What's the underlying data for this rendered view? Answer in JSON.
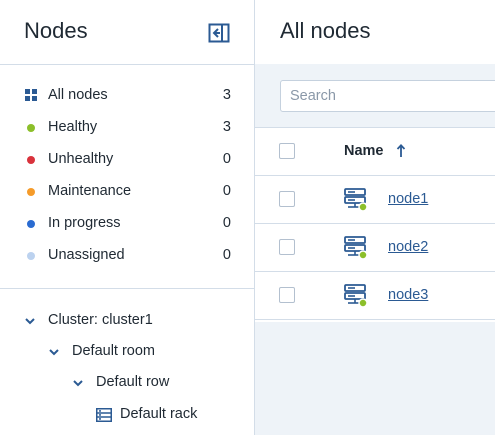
{
  "sidebar": {
    "title": "Nodes",
    "collapse_icon": "collapse-panel-icon",
    "filters": [
      {
        "label": "All nodes",
        "count": "3",
        "icon": "grid-icon",
        "color": "#2b5a93"
      },
      {
        "label": "Healthy",
        "count": "3",
        "icon": "status-dot-icon",
        "color": "#8cbf2a"
      },
      {
        "label": "Unhealthy",
        "count": "0",
        "icon": "status-dot-icon",
        "color": "#d9323c"
      },
      {
        "label": "Maintenance",
        "count": "0",
        "icon": "status-dot-icon",
        "color": "#f59b2a"
      },
      {
        "label": "In progress",
        "count": "0",
        "icon": "status-dot-icon",
        "color": "#2a6bd1"
      },
      {
        "label": "Unassigned",
        "count": "0",
        "icon": "status-dot-icon",
        "color": "#bcd2ef"
      }
    ],
    "tree": [
      {
        "label": "Cluster: cluster1",
        "icon": "chevron-down-icon"
      },
      {
        "label": "Default room",
        "icon": "chevron-down-icon"
      },
      {
        "label": "Default row",
        "icon": "chevron-down-icon"
      },
      {
        "label": "Default rack",
        "icon": "rack-icon"
      }
    ]
  },
  "main": {
    "title": "All nodes",
    "search": {
      "placeholder": "Search",
      "value": ""
    },
    "table": {
      "columns": [
        {
          "label": "Name",
          "sort": "ascending",
          "sort_icon": "arrow-up-icon"
        }
      ],
      "rows": [
        {
          "name": "node1",
          "icon": "server-node-icon",
          "status": "Healthy"
        },
        {
          "name": "node2",
          "icon": "server-node-icon",
          "status": "Healthy"
        },
        {
          "name": "node3",
          "icon": "server-node-icon",
          "status": "Healthy"
        }
      ]
    }
  },
  "colors": {
    "accent": "#2b5a93",
    "healthy": "#8cbf2a",
    "border": "#d3dde8",
    "background": "#eef3f8"
  }
}
